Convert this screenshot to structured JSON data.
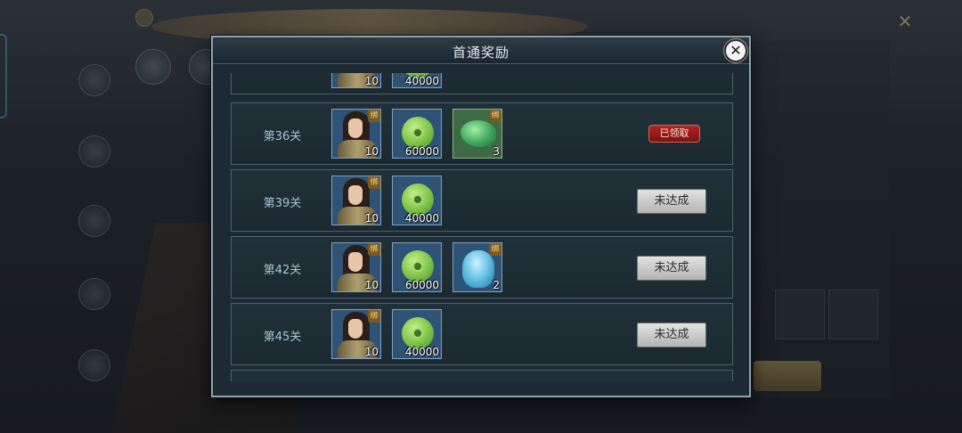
{
  "dialog": {
    "title": "首通奖励"
  },
  "rows": [
    {
      "stage": "",
      "items": [
        {
          "icon": "hero-portrait-icon",
          "count": "10",
          "bound": false
        },
        {
          "icon": "jade-coin-icon",
          "count": "40000",
          "bound": false
        }
      ],
      "status": "",
      "partial": true
    },
    {
      "stage": "第36关",
      "items": [
        {
          "icon": "hero-portrait-icon",
          "count": "10",
          "bound": true
        },
        {
          "icon": "jade-coin-icon",
          "count": "60000",
          "bound": false
        },
        {
          "icon": "jade-stone-icon",
          "count": "3",
          "bound": true
        }
      ],
      "status": "已领取",
      "status_type": "claimed"
    },
    {
      "stage": "第39关",
      "items": [
        {
          "icon": "hero-portrait-icon",
          "count": "10",
          "bound": true
        },
        {
          "icon": "jade-coin-icon",
          "count": "40000",
          "bound": false
        }
      ],
      "status": "未达成",
      "status_type": "unreached"
    },
    {
      "stage": "第42关",
      "items": [
        {
          "icon": "hero-portrait-icon",
          "count": "10",
          "bound": true
        },
        {
          "icon": "jade-coin-icon",
          "count": "60000",
          "bound": false
        },
        {
          "icon": "blue-crystal-icon",
          "count": "2",
          "bound": true
        }
      ],
      "status": "未达成",
      "status_type": "unreached"
    },
    {
      "stage": "第45关",
      "items": [
        {
          "icon": "hero-portrait-icon",
          "count": "10",
          "bound": true
        },
        {
          "icon": "jade-coin-icon",
          "count": "40000",
          "bound": false
        }
      ],
      "status": "未达成",
      "status_type": "unreached"
    }
  ],
  "bind_label": "绑",
  "colors": {
    "claimed": "#b02424",
    "dialog_bg": "#1d2a33",
    "row_border": "#4d606b"
  }
}
